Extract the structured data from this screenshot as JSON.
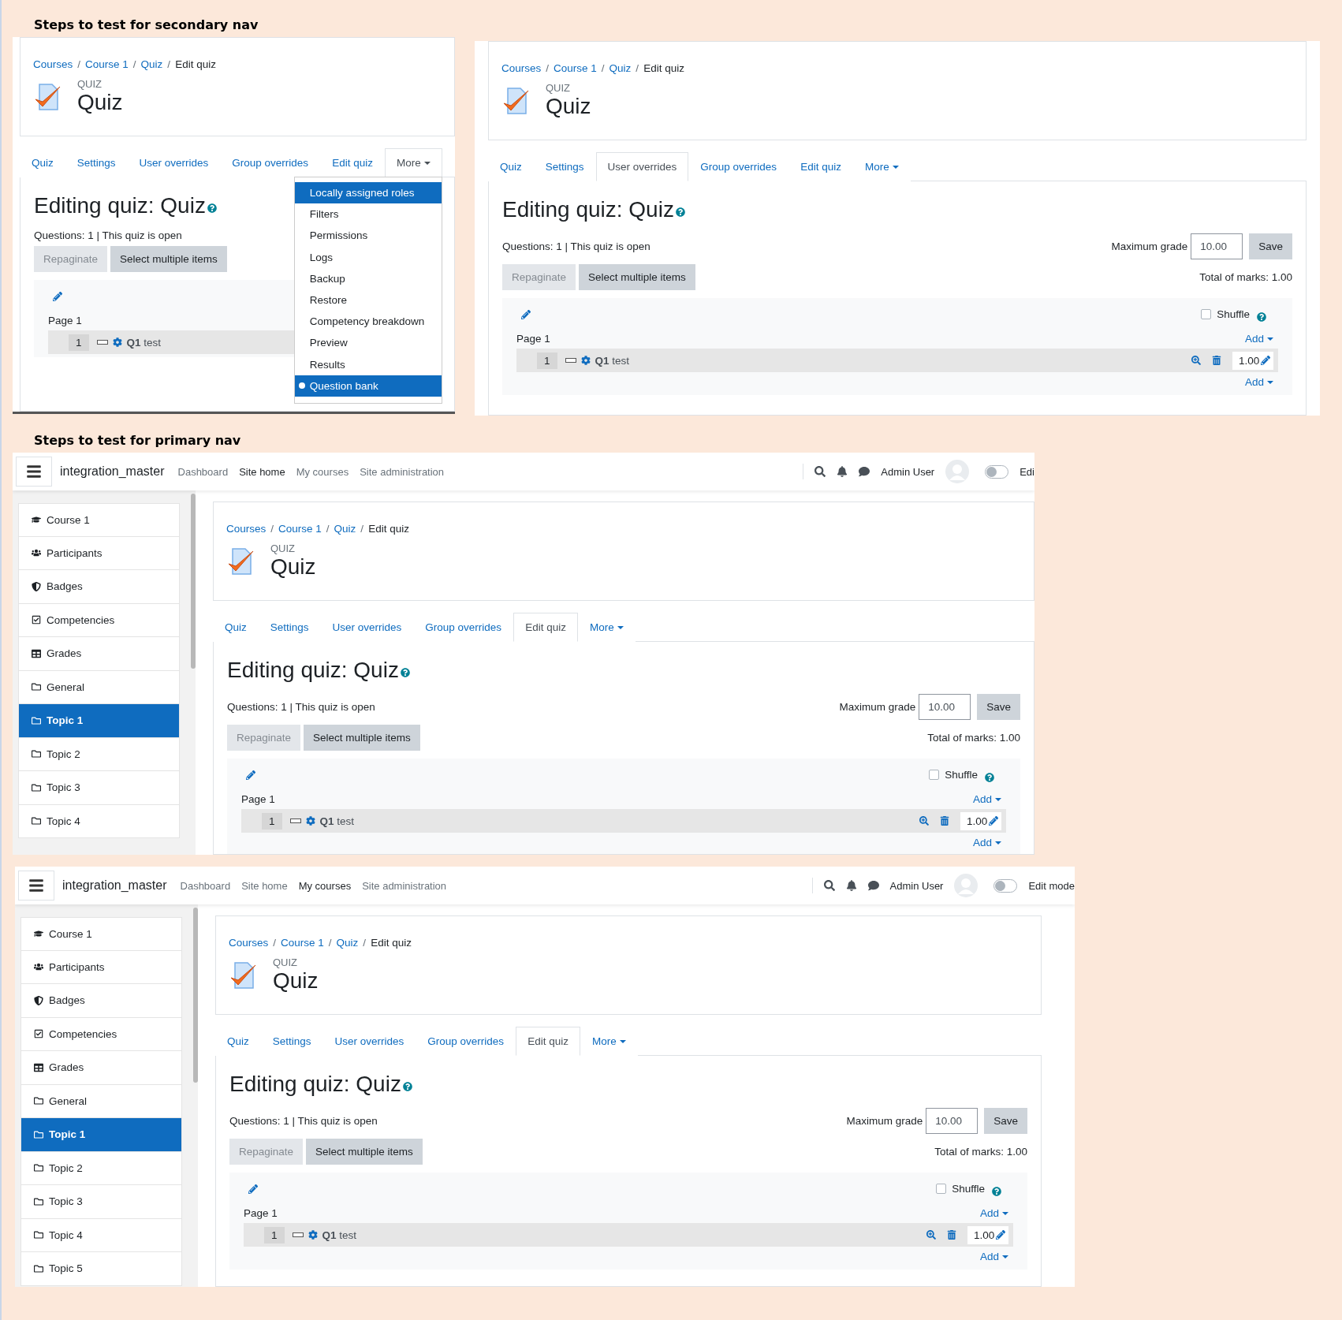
{
  "sections": [
    {
      "heading": "Steps to test for secondary nav",
      "screens": [
        {
          "breadcrumb": [
            "Courses",
            "Course 1",
            "Quiz",
            "Edit quiz"
          ],
          "activity_type": "QUIZ",
          "title": "Quiz",
          "tabs": [
            {
              "label": "Quiz",
              "kind": "link",
              "selected": false
            },
            {
              "label": "Settings",
              "kind": "link",
              "selected": false
            },
            {
              "label": "User overrides",
              "kind": "link",
              "selected": false
            },
            {
              "label": "Group overrides",
              "kind": "link",
              "selected": false
            },
            {
              "label": "Edit quiz",
              "kind": "link",
              "selected": false
            },
            {
              "label": "More",
              "kind": "menu",
              "selected": true
            }
          ],
          "breadcrumb_separator": "/",
          "dropdown": [
            {
              "label": "Locally assigned roles",
              "highlighted": true,
              "selected": false
            },
            {
              "label": "Filters",
              "highlighted": false,
              "selected": false
            },
            {
              "label": "Permissions",
              "highlighted": false,
              "selected": false
            },
            {
              "label": "Logs",
              "highlighted": false,
              "selected": false
            },
            {
              "label": "Backup",
              "highlighted": false,
              "selected": false
            },
            {
              "label": "Restore",
              "highlighted": false,
              "selected": false
            },
            {
              "label": "Competency breakdown",
              "highlighted": false,
              "selected": false
            },
            {
              "label": "Preview",
              "highlighted": false,
              "selected": false
            },
            {
              "label": "Results",
              "highlighted": false,
              "selected": false
            },
            {
              "label": "Question bank",
              "highlighted": true,
              "selected": true
            }
          ],
          "heading": "Editing quiz: Quiz",
          "summary": "Questions: 1 | This quiz is open",
          "buttons": [
            {
              "label": "Repaginate",
              "disabled": true
            },
            {
              "label": "Select multiple items",
              "disabled": false
            }
          ],
          "page_label": "Page 1",
          "question": {
            "number": "1",
            "name": "Q1",
            "text": "test"
          }
        },
        {
          "breadcrumb": [
            "Courses",
            "Course 1",
            "Quiz",
            "Edit quiz"
          ],
          "activity_type": "QUIZ",
          "title": "Quiz",
          "breadcrumb_separator": "/",
          "tabs": [
            {
              "label": "Quiz",
              "kind": "link",
              "selected": false
            },
            {
              "label": "Settings",
              "kind": "link",
              "selected": false
            },
            {
              "label": "User overrides",
              "kind": "link",
              "selected": true
            },
            {
              "label": "Group overrides",
              "kind": "link",
              "selected": false
            },
            {
              "label": "Edit quiz",
              "kind": "link",
              "selected": false
            },
            {
              "label": "More",
              "kind": "menu",
              "selected": false
            }
          ],
          "heading": "Editing quiz: Quiz",
          "summary": "Questions: 1 | This quiz is open",
          "max_grade": {
            "label": "Maximum grade",
            "value": "10.00",
            "button": "Save"
          },
          "total": "Total of marks: 1.00",
          "buttons": [
            {
              "label": "Repaginate",
              "disabled": true
            },
            {
              "label": "Select multiple items",
              "disabled": false
            }
          ],
          "shuffle": {
            "label": "Shuffle",
            "checked": false
          },
          "page_label": "Page 1",
          "add_links": [
            "Add",
            "Add"
          ],
          "question": {
            "number": "1",
            "name": "Q1",
            "text": "test",
            "mark": "1.00"
          }
        }
      ]
    },
    {
      "heading": "Steps to test for primary nav",
      "screens": [
        {
          "navbar": {
            "site_name": "integration_master",
            "links": [
              {
                "label": "Dashboard",
                "selected": false
              },
              {
                "label": "Site home",
                "selected": true
              },
              {
                "label": "My courses",
                "selected": false
              },
              {
                "label": "Site administration",
                "selected": false
              }
            ],
            "user": "Admin User",
            "edit_mode": {
              "label": "Edi",
              "on": false
            }
          },
          "sidebar": [
            {
              "label": "Course 1",
              "selected": false
            },
            {
              "label": "Participants",
              "selected": false
            },
            {
              "label": "Badges",
              "selected": false
            },
            {
              "label": "Competencies",
              "selected": false
            },
            {
              "label": "Grades",
              "selected": false
            },
            {
              "label": "General",
              "selected": false
            },
            {
              "label": "Topic 1",
              "selected": true
            },
            {
              "label": "Topic 2",
              "selected": false
            },
            {
              "label": "Topic 3",
              "selected": false
            },
            {
              "label": "Topic 4",
              "selected": false
            }
          ],
          "breadcrumb_separator": "/",
          "breadcrumb": [
            "Courses",
            "Course 1",
            "Quiz",
            "Edit quiz"
          ],
          "activity_type": "QUIZ",
          "title": "Quiz",
          "tabs": [
            {
              "label": "Quiz",
              "kind": "link",
              "selected": false
            },
            {
              "label": "Settings",
              "kind": "link",
              "selected": false
            },
            {
              "label": "User overrides",
              "kind": "link",
              "selected": false
            },
            {
              "label": "Group overrides",
              "kind": "link",
              "selected": false
            },
            {
              "label": "Edit quiz",
              "kind": "link",
              "selected": true
            },
            {
              "label": "More",
              "kind": "menu",
              "selected": false
            }
          ],
          "heading": "Editing quiz: Quiz",
          "summary": "Questions: 1 | This quiz is open",
          "max_grade": {
            "label": "Maximum grade",
            "value": "10.00",
            "button": "Save"
          },
          "total": "Total of marks: 1.00",
          "buttons": [
            {
              "label": "Repaginate",
              "disabled": true
            },
            {
              "label": "Select multiple items",
              "disabled": false
            }
          ],
          "shuffle": {
            "label": "Shuffle",
            "checked": false
          },
          "page_label": "Page 1",
          "add_links": [
            "Add",
            "Add"
          ],
          "question": {
            "number": "1",
            "name": "Q1",
            "text": "test",
            "mark": "1.00"
          }
        },
        {
          "navbar": {
            "site_name": "integration_master",
            "links": [
              {
                "label": "Dashboard",
                "selected": false
              },
              {
                "label": "Site home",
                "selected": false
              },
              {
                "label": "My courses",
                "selected": true
              },
              {
                "label": "Site administration",
                "selected": false
              }
            ],
            "user": "Admin User",
            "edit_mode": {
              "label": "Edit mode",
              "on": false
            }
          },
          "sidebar": [
            {
              "label": "Course 1",
              "selected": false
            },
            {
              "label": "Participants",
              "selected": false
            },
            {
              "label": "Badges",
              "selected": false
            },
            {
              "label": "Competencies",
              "selected": false
            },
            {
              "label": "Grades",
              "selected": false
            },
            {
              "label": "General",
              "selected": false
            },
            {
              "label": "Topic 1",
              "selected": true
            },
            {
              "label": "Topic 2",
              "selected": false
            },
            {
              "label": "Topic 3",
              "selected": false
            },
            {
              "label": "Topic 4",
              "selected": false
            },
            {
              "label": "Topic 5",
              "selected": false
            }
          ],
          "breadcrumb_separator": "/",
          "breadcrumb": [
            "Courses",
            "Course 1",
            "Quiz",
            "Edit quiz"
          ],
          "activity_type": "QUIZ",
          "title": "Quiz",
          "tabs": [
            {
              "label": "Quiz",
              "kind": "link",
              "selected": false
            },
            {
              "label": "Settings",
              "kind": "link",
              "selected": false
            },
            {
              "label": "User overrides",
              "kind": "link",
              "selected": false
            },
            {
              "label": "Group overrides",
              "kind": "link",
              "selected": false
            },
            {
              "label": "Edit quiz",
              "kind": "link",
              "selected": true
            },
            {
              "label": "More",
              "kind": "menu",
              "selected": false
            }
          ],
          "heading": "Editing quiz: Quiz",
          "summary": "Questions: 1 | This quiz is open",
          "max_grade": {
            "label": "Maximum grade",
            "value": "10.00",
            "button": "Save"
          },
          "total": "Total of marks: 1.00",
          "buttons": [
            {
              "label": "Repaginate",
              "disabled": true
            },
            {
              "label": "Select multiple items",
              "disabled": false
            }
          ],
          "shuffle": {
            "label": "Shuffle",
            "checked": false
          },
          "page_label": "Page 1",
          "add_links": [
            "Add",
            "Add"
          ],
          "question": {
            "number": "1",
            "name": "Q1",
            "text": "test",
            "mark": "1.00"
          }
        }
      ]
    }
  ]
}
